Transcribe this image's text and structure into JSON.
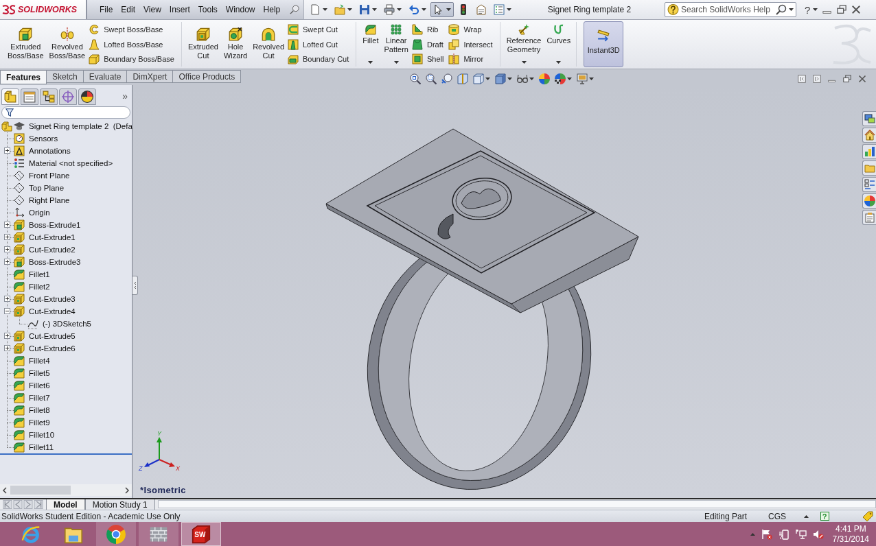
{
  "title_bar": {
    "logo": "SOLIDWORKS",
    "menu": [
      "File",
      "Edit",
      "View",
      "Insert",
      "Tools",
      "Window",
      "Help"
    ],
    "quick_access": [
      {
        "kind": "new",
        "dropdown": true,
        "pressed": false
      },
      {
        "kind": "open",
        "dropdown": true,
        "pressed": false
      },
      {
        "kind": "save",
        "dropdown": true,
        "pressed": false
      },
      {
        "kind": "print",
        "dropdown": true,
        "pressed": false
      },
      {
        "kind": "undo",
        "dropdown": true,
        "pressed": false
      },
      {
        "kind": "select",
        "dropdown": true,
        "pressed": true
      },
      {
        "kind": "rebuild",
        "dropdown": false,
        "pressed": false
      },
      {
        "kind": "properties",
        "dropdown": false,
        "pressed": false
      },
      {
        "kind": "options",
        "dropdown": true,
        "pressed": false
      }
    ],
    "document_title": "Signet Ring template 2",
    "search": {
      "placeholder": "Search SolidWorks Help"
    },
    "help": "?"
  },
  "ribbon": {
    "groups": [
      {
        "large": [
          {
            "kind": "extrude",
            "label": "Extruded Boss/Base",
            "dropdown": false
          },
          {
            "kind": "revolve",
            "label": "Revolved Boss/Base",
            "dropdown": false
          }
        ],
        "stacks": [
          [
            {
              "kind": "sweep",
              "label": "Swept Boss/Base"
            },
            {
              "kind": "loft",
              "label": "Lofted Boss/Base"
            },
            {
              "kind": "boundary",
              "label": "Boundary Boss/Base"
            }
          ]
        ]
      },
      {
        "large": [
          {
            "kind": "cutextrude",
            "label": "Extruded Cut",
            "dropdown": false
          },
          {
            "kind": "hole",
            "label": "Hole Wizard",
            "dropdown": false
          },
          {
            "kind": "cutrevolve",
            "label": "Revolved Cut",
            "dropdown": false
          }
        ],
        "stacks": [
          [
            {
              "kind": "cutsweep",
              "label": "Swept Cut"
            },
            {
              "kind": "cutloft",
              "label": "Lofted Cut"
            },
            {
              "kind": "cutboundary",
              "label": "Boundary Cut"
            }
          ]
        ]
      },
      {
        "large": [
          {
            "kind": "fillet",
            "label": "Fillet",
            "dropdown": true
          },
          {
            "kind": "pattern",
            "label": "Linear Pattern",
            "dropdown": true
          }
        ],
        "stacks": [
          [
            {
              "kind": "rib",
              "label": "Rib"
            },
            {
              "kind": "draft",
              "label": "Draft"
            },
            {
              "kind": "shell",
              "label": "Shell"
            }
          ],
          [
            {
              "kind": "wrap",
              "label": "Wrap"
            },
            {
              "kind": "intersect",
              "label": "Intersect"
            },
            {
              "kind": "mirror",
              "label": "Mirror"
            }
          ]
        ]
      },
      {
        "large": [
          {
            "kind": "refgeom",
            "label": "Reference Geometry",
            "dropdown": true
          },
          {
            "kind": "curves",
            "label": "Curves",
            "dropdown": true
          }
        ]
      }
    ],
    "toggle": {
      "kind": "instant3d",
      "label": "Instant3D",
      "selected": true
    }
  },
  "command_tabs": [
    {
      "label": "Features",
      "selected": true
    },
    {
      "label": "Sketch",
      "selected": false
    },
    {
      "label": "Evaluate",
      "selected": false
    },
    {
      "label": "DimXpert",
      "selected": false
    },
    {
      "label": "Office Products",
      "selected": false
    }
  ],
  "view_toolbar": [
    {
      "kind": "zoomfit",
      "dropdown": false
    },
    {
      "kind": "zoomarea",
      "dropdown": false
    },
    {
      "kind": "previous",
      "dropdown": false
    },
    {
      "kind": "section",
      "dropdown": false
    },
    {
      "kind": "orientation",
      "dropdown": true
    },
    {
      "kind": "display",
      "dropdown": true
    },
    {
      "kind": "hideshow",
      "dropdown": true
    },
    {
      "kind": "appearance",
      "dropdown": false
    },
    {
      "kind": "scene",
      "dropdown": true
    },
    {
      "kind": "settings",
      "dropdown": true
    }
  ],
  "feature_manager": {
    "tabs": [
      {
        "kind": "tree",
        "selected": true
      },
      {
        "kind": "property",
        "selected": false
      },
      {
        "kind": "config",
        "selected": false
      },
      {
        "kind": "dimxpert",
        "selected": false
      },
      {
        "kind": "display",
        "selected": false
      }
    ],
    "more": "»",
    "tree": {
      "kind": "part",
      "label": "Signet Ring template 2  (Defa",
      "children": [
        {
          "kind": "sensors",
          "label": "Sensors"
        },
        {
          "kind": "annotations",
          "label": "Annotations",
          "expanded": false
        },
        {
          "kind": "material",
          "label": "Material <not specified>"
        },
        {
          "kind": "plane",
          "label": "Front Plane"
        },
        {
          "kind": "plane",
          "label": "Top Plane"
        },
        {
          "kind": "plane",
          "label": "Right Plane"
        },
        {
          "kind": "origin",
          "label": "Origin"
        },
        {
          "kind": "boss",
          "label": "Boss-Extrude1",
          "expanded": false
        },
        {
          "kind": "cut",
          "label": "Cut-Extrude1",
          "expanded": false
        },
        {
          "kind": "cut",
          "label": "Cut-Extrude2",
          "expanded": false
        },
        {
          "kind": "boss",
          "label": "Boss-Extrude3",
          "expanded": false
        },
        {
          "kind": "fillet",
          "label": "Fillet1"
        },
        {
          "kind": "fillet",
          "label": "Fillet2"
        },
        {
          "kind": "cut",
          "label": "Cut-Extrude3",
          "expanded": false
        },
        {
          "kind": "cut",
          "label": "Cut-Extrude4",
          "expanded": true,
          "children": [
            {
              "kind": "sketch3d",
              "label": "(-) 3DSketch5"
            }
          ]
        },
        {
          "kind": "cut",
          "label": "Cut-Extrude5",
          "expanded": false
        },
        {
          "kind": "cut",
          "label": "Cut-Extrude6",
          "expanded": false
        },
        {
          "kind": "fillet",
          "label": "Fillet4"
        },
        {
          "kind": "fillet",
          "label": "Fillet5"
        },
        {
          "kind": "fillet",
          "label": "Fillet6"
        },
        {
          "kind": "fillet",
          "label": "Fillet7"
        },
        {
          "kind": "fillet",
          "label": "Fillet8"
        },
        {
          "kind": "fillet",
          "label": "Fillet9"
        },
        {
          "kind": "fillet",
          "label": "Fillet10"
        },
        {
          "kind": "fillet",
          "label": "Fillet11"
        }
      ]
    }
  },
  "viewport": {
    "axes": {
      "x": "X",
      "y": "Y",
      "z": "Z"
    },
    "view_name": "*Isometric"
  },
  "model_tabs": [
    {
      "label": "Model",
      "selected": true
    },
    {
      "label": "Motion Study 1",
      "selected": false
    }
  ],
  "status_bar": {
    "message": "SolidWorks Student Edition - Academic Use Only",
    "mode": "Editing Part",
    "units": "CGS",
    "help": "?"
  },
  "taskbar": {
    "apps": [
      {
        "kind": "ie",
        "running": false,
        "selected": false
      },
      {
        "kind": "explorer",
        "running": false,
        "selected": false
      },
      {
        "kind": "chrome",
        "running": true,
        "selected": false
      },
      {
        "kind": "wall",
        "running": true,
        "selected": false
      },
      {
        "kind": "solidworks",
        "running": true,
        "selected": true,
        "label": "SW"
      }
    ],
    "time": "4:41 PM",
    "date": "7/31/2014"
  }
}
